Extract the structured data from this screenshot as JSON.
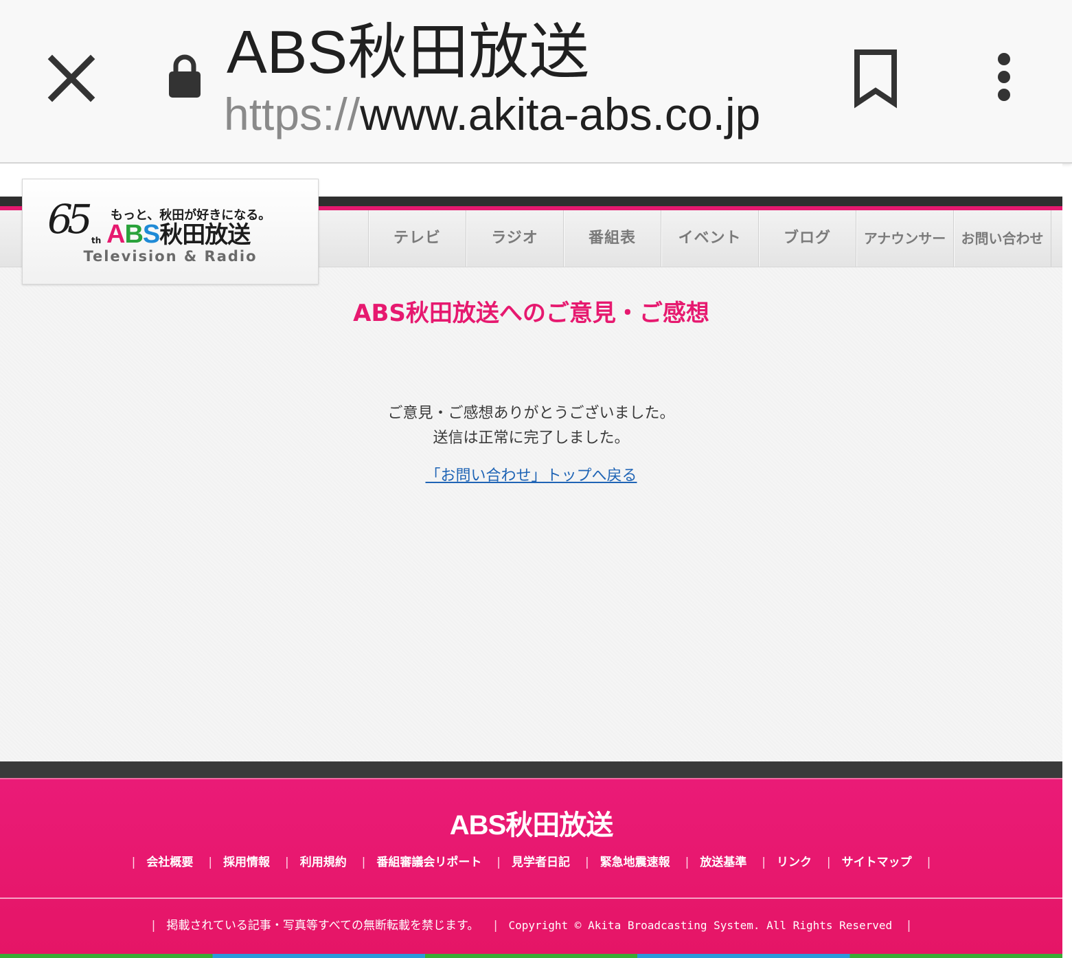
{
  "browser": {
    "title": "ABS秋田放送",
    "url_scheme": "https://",
    "url_host": "www.akita-abs.co.jp",
    "icons": [
      "close-icon",
      "lock-icon",
      "bookmark-icon",
      "more-vert-icon"
    ]
  },
  "header": {
    "logo": {
      "anniversary": "65",
      "anniversary_suffix": "th",
      "slogan": "もっと、秋田が好きになる。",
      "wordmark_a": "A",
      "wordmark_b": "B",
      "wordmark_s": "S",
      "wordmark_jp": "秋田放送",
      "tagline": "Television & Radio"
    },
    "nav": [
      "テレビ",
      "ラジオ",
      "番組表",
      "イベント",
      "ブログ",
      "アナウンサー",
      "お問い合わせ"
    ]
  },
  "main": {
    "title": "ABS秋田放送へのご意見・ご感想",
    "message_line1": "ご意見・ご感想ありがとうございました。",
    "message_line2": "送信は正常に完了しました。",
    "back_link": "「お問い合わせ」トップへ戻る"
  },
  "footer": {
    "logo": "ABS秋田放送",
    "links": [
      "会社概要",
      "採用情報",
      "利用規約",
      "番組審議会リポート",
      "見学者日記",
      "緊急地震速報",
      "放送基準",
      "リンク",
      "サイトマップ"
    ],
    "notice": "掲載されている記事・写真等すべての無断転載を禁じます。",
    "copyright": "Copyright © Akita Broadcasting System. All Rights Reserved"
  },
  "colors": {
    "brand_pink": "#e6196f",
    "link_blue": "#1f64b5",
    "dark_bar": "#2f2f2f",
    "logo_green": "#2aa23b",
    "logo_blue": "#1f8ad6"
  }
}
